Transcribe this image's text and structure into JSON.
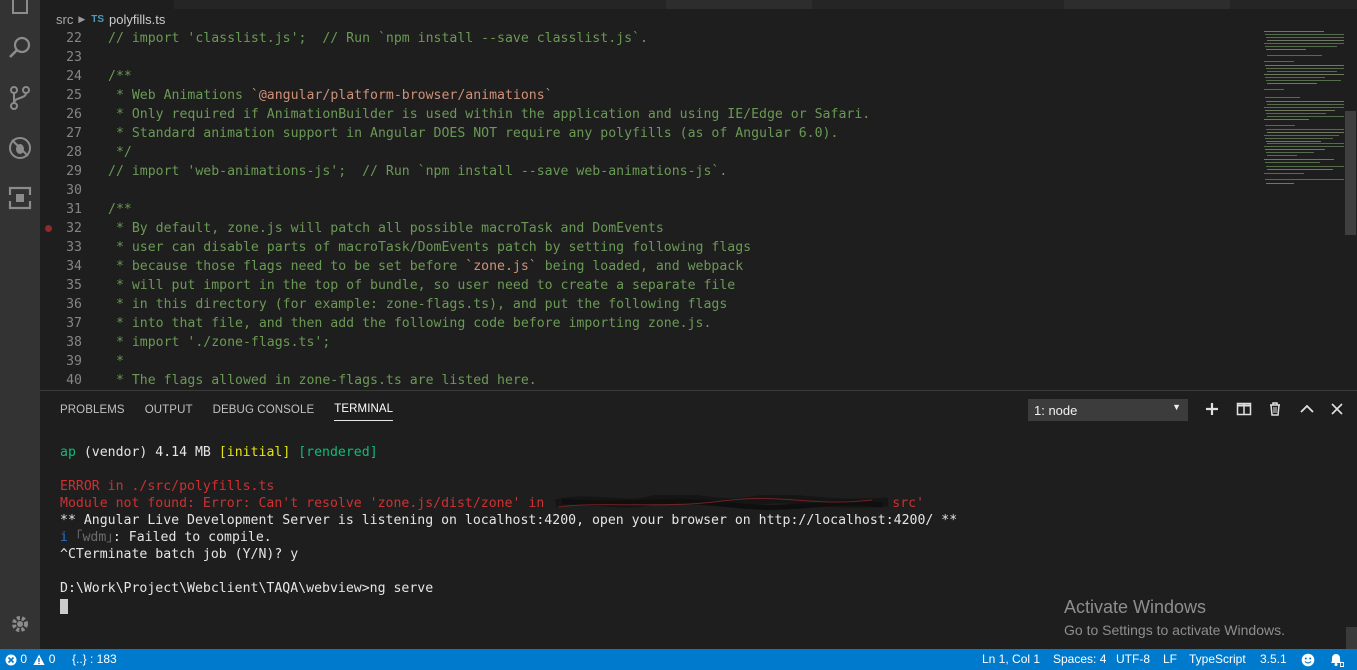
{
  "breadcrumb": {
    "folder": "src",
    "lang_badge": "TS",
    "file": "polyfills.ts"
  },
  "editor": {
    "lines": [
      {
        "n": "22",
        "segs": [
          {
            "t": "// import 'classlist.js';  // Run `npm install --save classlist.js`.",
            "c": "cmt"
          }
        ]
      },
      {
        "n": "23",
        "segs": []
      },
      {
        "n": "24",
        "segs": [
          {
            "t": "/**",
            "c": "cmt"
          }
        ]
      },
      {
        "n": "25",
        "segs": [
          {
            "t": " * Web Animations ",
            "c": "cmt"
          },
          {
            "t": "`@angular/platform-browser/animations`",
            "c": "str"
          }
        ]
      },
      {
        "n": "26",
        "segs": [
          {
            "t": " * Only required if AnimationBuilder is used within the application and using IE/Edge or Safari.",
            "c": "cmt"
          }
        ]
      },
      {
        "n": "27",
        "segs": [
          {
            "t": " * Standard animation support in Angular DOES NOT require any polyfills (as of Angular 6.0).",
            "c": "cmt"
          }
        ]
      },
      {
        "n": "28",
        "segs": [
          {
            "t": " */",
            "c": "cmt"
          }
        ]
      },
      {
        "n": "29",
        "segs": [
          {
            "t": "// import 'web-animations-js';  // Run `npm install --save web-animations-js`.",
            "c": "cmt"
          }
        ]
      },
      {
        "n": "30",
        "segs": []
      },
      {
        "n": "31",
        "segs": [
          {
            "t": "/**",
            "c": "cmt"
          }
        ]
      },
      {
        "n": "32",
        "bp": true,
        "segs": [
          {
            "t": " * By default, zone.js will patch all possible macroTask and DomEvents",
            "c": "cmt"
          }
        ]
      },
      {
        "n": "33",
        "segs": [
          {
            "t": " * user can disable parts of macroTask/DomEvents patch by setting following flags",
            "c": "cmt"
          }
        ]
      },
      {
        "n": "34",
        "segs": [
          {
            "t": " * because those flags need to be set before ",
            "c": "cmt"
          },
          {
            "t": "`zone.js`",
            "c": "str"
          },
          {
            "t": " being loaded, and webpack",
            "c": "cmt"
          }
        ]
      },
      {
        "n": "35",
        "segs": [
          {
            "t": " * will put import in the top of bundle, so user need to create a separate file",
            "c": "cmt"
          }
        ]
      },
      {
        "n": "36",
        "segs": [
          {
            "t": " * in this directory (for example: zone-flags.ts), and put the following flags",
            "c": "cmt"
          }
        ]
      },
      {
        "n": "37",
        "segs": [
          {
            "t": " * into that file, and then add the following code before importing zone.js.",
            "c": "cmt"
          }
        ]
      },
      {
        "n": "38",
        "segs": [
          {
            "t": " * import './zone-flags.ts';",
            "c": "cmt"
          }
        ]
      },
      {
        "n": "39",
        "segs": [
          {
            "t": " *",
            "c": "cmt"
          }
        ]
      },
      {
        "n": "40",
        "segs": [
          {
            "t": " * The flags allowed in zone-flags.ts are listed here.",
            "c": "cmt"
          }
        ]
      }
    ]
  },
  "panel": {
    "tabs": [
      {
        "label": "PROBLEMS",
        "active": false
      },
      {
        "label": "OUTPUT",
        "active": false
      },
      {
        "label": "DEBUG CONSOLE",
        "active": false
      },
      {
        "label": "TERMINAL",
        "active": true
      }
    ],
    "terminal_select": "1: node",
    "actions": [
      "plus-icon",
      "split-icon",
      "trash-icon",
      "chevron-up-icon",
      "close-icon"
    ]
  },
  "terminal": {
    "lines": [
      {
        "segs": [
          {
            "t": "ap",
            "c": "t-green"
          },
          {
            "t": " (vendor) 4.14 MB ",
            "c": "t-white"
          },
          {
            "t": "[initial]",
            "c": "t-yellow"
          },
          {
            "t": " ",
            "c": "t-white"
          },
          {
            "t": "[rendered]",
            "c": "t-green"
          }
        ]
      },
      {
        "segs": []
      },
      {
        "segs": [
          {
            "t": "ERROR in ./src/polyfills.ts",
            "c": "t-red"
          }
        ]
      },
      {
        "segs": [
          {
            "t": "Module not found: Error: Can't resolve 'zone.js/dist/zone' in ",
            "c": "t-red"
          },
          {
            "t": "SCRIBBLE",
            "c": "scribble"
          },
          {
            "t": "src'",
            "c": "t-red"
          }
        ]
      },
      {
        "segs": [
          {
            "t": "** Angular Live Development Server is listening on localhost:4200, open your browser on http://localhost:4200/ **",
            "c": "t-white"
          }
        ]
      },
      {
        "segs": [
          {
            "t": "i",
            "c": "t-blue"
          },
          {
            "t": " ｢wdm｣",
            "c": "t-dim"
          },
          {
            "t": ": Failed to compile.",
            "c": "t-white"
          }
        ]
      },
      {
        "segs": [
          {
            "t": "^CTerminate batch job (Y/N)? y",
            "c": "t-white"
          }
        ]
      },
      {
        "segs": []
      },
      {
        "segs": [
          {
            "t": "D:\\Work\\Project\\Webclient\\TAQA\\webview>ng serve",
            "c": "t-white"
          }
        ]
      }
    ]
  },
  "watermark": {
    "line1": "Activate Windows",
    "line2": "Go to Settings to activate Windows."
  },
  "statusbar": {
    "errors": "0",
    "warnings": "0",
    "braces": "{..} : 183",
    "position": "Ln 1, Col 1",
    "spaces": "Spaces: 4",
    "encoding": "UTF-8",
    "eol": "LF",
    "language": "TypeScript",
    "version": "3.5.1"
  },
  "colors": {
    "accent": "#007acc",
    "activity_bar": "#333333",
    "editor_bg": "#1e1e1e",
    "comment": "#6a9955",
    "string": "#ce9178",
    "error": "#cd3131"
  }
}
